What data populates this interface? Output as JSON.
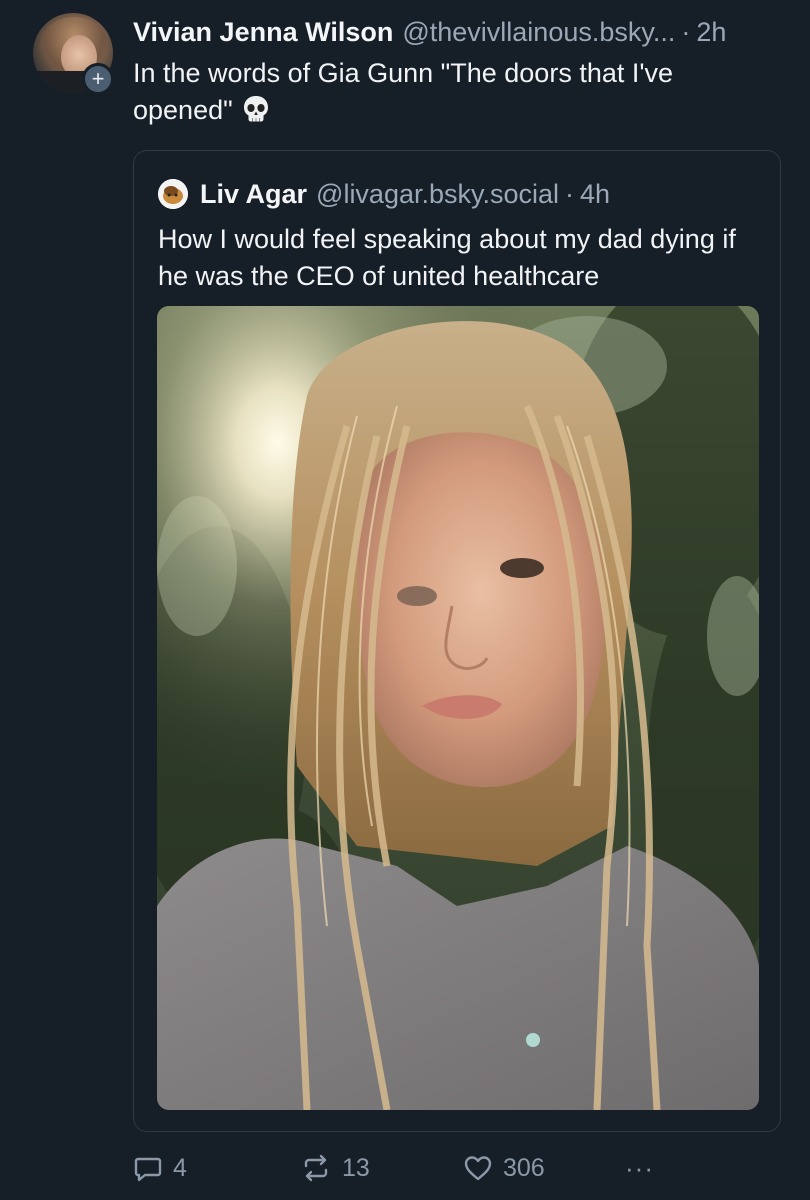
{
  "post": {
    "author": {
      "display_name": "Vivian Jenna Wilson",
      "handle": "@thevivllainous.bsky...",
      "time": "2h"
    },
    "separator": "·",
    "follow_button": "+",
    "text": "In the words of Gia Gunn \"The doors that I've opened\"",
    "emoji_icon": "skull-icon"
  },
  "quote": {
    "author": {
      "display_name": "Liv Agar",
      "handle": "@livagar.bsky.social",
      "time": "4h"
    },
    "separator": "·",
    "text": "How I would feel speaking about my dad dying if he was the CEO of united healthcare"
  },
  "actions": {
    "reply_count": "4",
    "repost_count": "13",
    "like_count": "306",
    "more_label": "···"
  },
  "colors": {
    "background": "#161e27",
    "text": "#f1f3f5",
    "muted": "#9aa8b7",
    "border": "#2e3a48",
    "icon": "#8b98a8"
  }
}
